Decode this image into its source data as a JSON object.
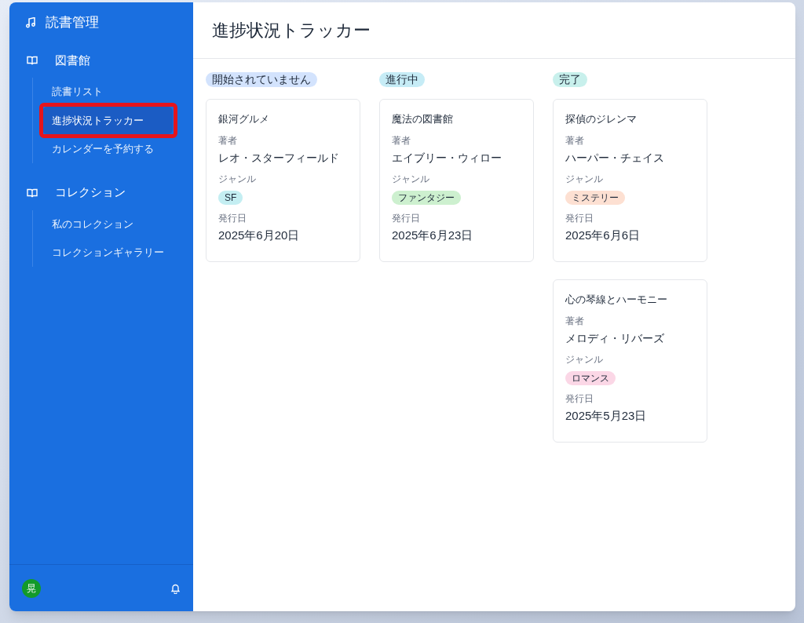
{
  "sidebar": {
    "app_title": "読書管理",
    "sections": [
      {
        "label": "図書館",
        "items": [
          {
            "label": "読書リスト",
            "selected": false,
            "highlighted": false
          },
          {
            "label": "進捗状況トラッカー",
            "selected": true,
            "highlighted": true
          },
          {
            "label": "カレンダーを予約する",
            "selected": false,
            "highlighted": false
          }
        ]
      },
      {
        "label": "コレクション",
        "items": [
          {
            "label": "私のコレクション",
            "selected": false,
            "highlighted": false
          },
          {
            "label": "コレクションギャラリー",
            "selected": false,
            "highlighted": false
          }
        ]
      }
    ],
    "user_avatar": "晃"
  },
  "page_title": "進捗状況トラッカー",
  "columns": [
    {
      "label": "開始されていません",
      "color": "#d3e3fd",
      "cards": [
        {
          "title": "銀河グルメ",
          "author_label": "著者",
          "author": "レオ・スターフィールド",
          "genre_label": "ジャンル",
          "genre": "SF",
          "color": "#c4eef2",
          "date_label": "発行日",
          "date": "2025年6月20日"
        }
      ]
    },
    {
      "label": "進行中",
      "color": "#c6ecf6",
      "cards": [
        {
          "title": "魔法の図書館",
          "author_label": "著者",
          "author": "エイブリー・ウィロー",
          "genre_label": "ジャンル",
          "genre": "ファンタジー",
          "color": "#cdf0cf",
          "date_label": "発行日",
          "date": "2025年6月23日"
        }
      ]
    },
    {
      "label": "完了",
      "color": "#c8f0ec",
      "cards": [
        {
          "title": "探偵のジレンマ",
          "author_label": "著者",
          "author": "ハーパー・チェイス",
          "genre_label": "ジャンル",
          "genre": "ミステリー",
          "color": "#fde0d2",
          "date_label": "発行日",
          "date": "2025年6月6日"
        },
        {
          "title": "心の琴線とハーモニー",
          "author_label": "著者",
          "author": "メロディ・リバーズ",
          "genre_label": "ジャンル",
          "genre": "ロマンス",
          "color": "#fbd7e6",
          "date_label": "発行日",
          "date": "2025年5月23日"
        }
      ]
    }
  ]
}
